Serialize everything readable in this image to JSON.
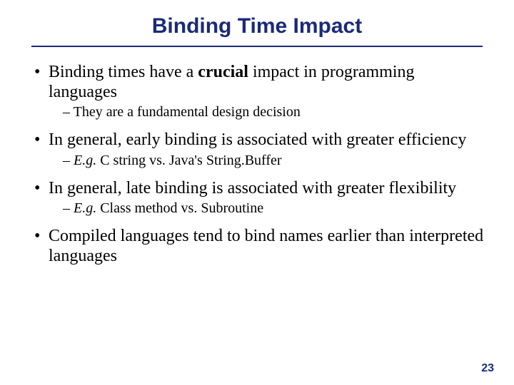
{
  "title": "Binding Time Impact",
  "bullets": [
    {
      "pre": "Binding times have a ",
      "strong": "crucial",
      "post": " impact in programming languages",
      "sub": {
        "text": "They are a fundamental design decision",
        "italic": false
      }
    },
    {
      "pre": "In general, early binding is associated with greater efficiency",
      "strong": "",
      "post": "",
      "sub": {
        "prefix": "E.g.",
        "rest": " C string vs. Java's String.Buffer",
        "italic": true
      }
    },
    {
      "pre": "In general, late binding is associated with greater flexibility",
      "strong": "",
      "post": "",
      "sub": {
        "prefix": "E.g.",
        "rest": " Class method vs. Subroutine",
        "italic": true
      }
    },
    {
      "pre": "Compiled languages tend to bind names earlier than interpreted languages",
      "strong": "",
      "post": "",
      "sub": null
    }
  ],
  "page_number": "23"
}
